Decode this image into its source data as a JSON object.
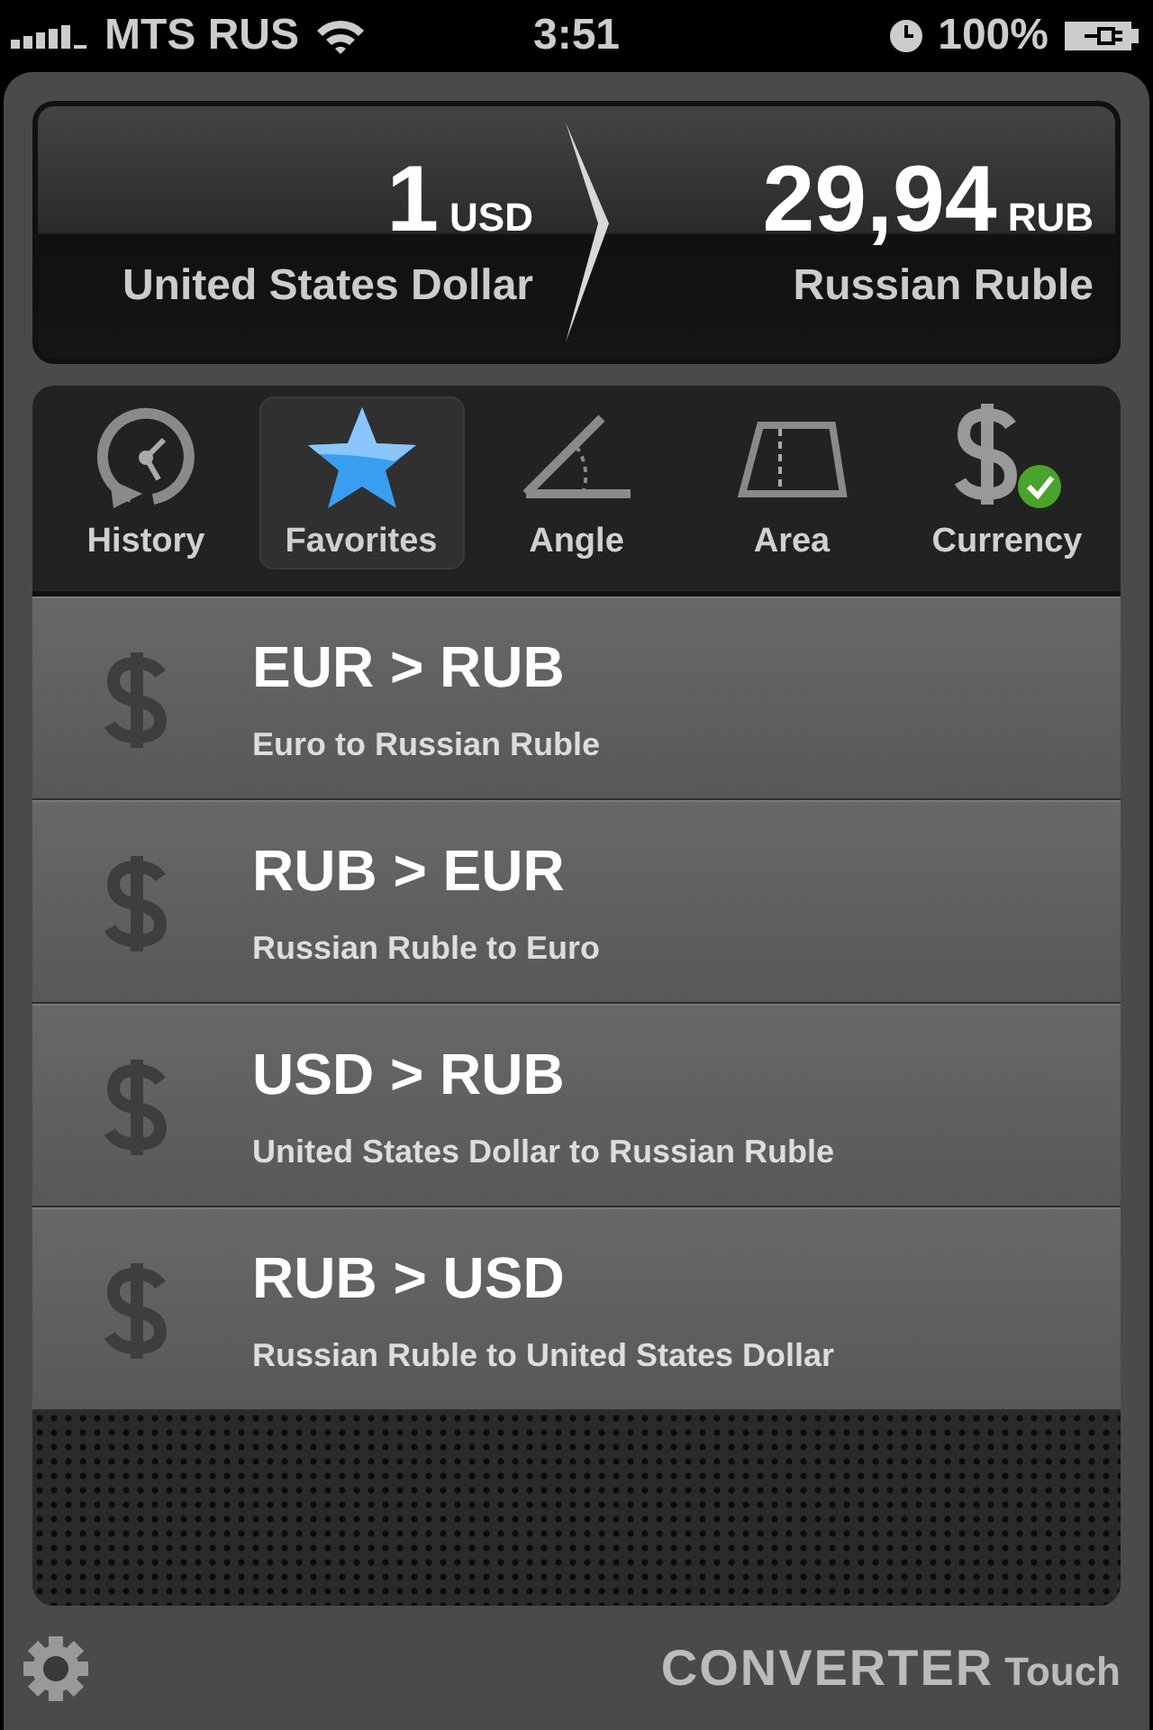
{
  "status_bar": {
    "carrier": "MTS RUS",
    "time": "3:51",
    "battery": "100%"
  },
  "display": {
    "from_amount": "1",
    "from_code": "USD",
    "from_name": "United States Dollar",
    "to_amount": "29,94",
    "to_code": "RUB",
    "to_name": "Russian Ruble"
  },
  "tabs": [
    {
      "label": "History",
      "kind": "history",
      "selected": false
    },
    {
      "label": "Favorites",
      "kind": "favorites",
      "selected": true
    },
    {
      "label": "Angle",
      "kind": "angle",
      "selected": false
    },
    {
      "label": "Area",
      "kind": "area",
      "selected": false
    },
    {
      "label": "Currency",
      "kind": "currency",
      "selected": false
    }
  ],
  "favorites": [
    {
      "title": "EUR > RUB",
      "subtitle": "Euro to Russian Ruble"
    },
    {
      "title": "RUB > EUR",
      "subtitle": "Russian Ruble to Euro"
    },
    {
      "title": "USD > RUB",
      "subtitle": "United States Dollar to Russian Ruble"
    },
    {
      "title": "RUB > USD",
      "subtitle": "Russian Ruble to United States Dollar"
    }
  ],
  "footer": {
    "logo_main": "CONVERTER",
    "logo_sub": "Touch"
  }
}
